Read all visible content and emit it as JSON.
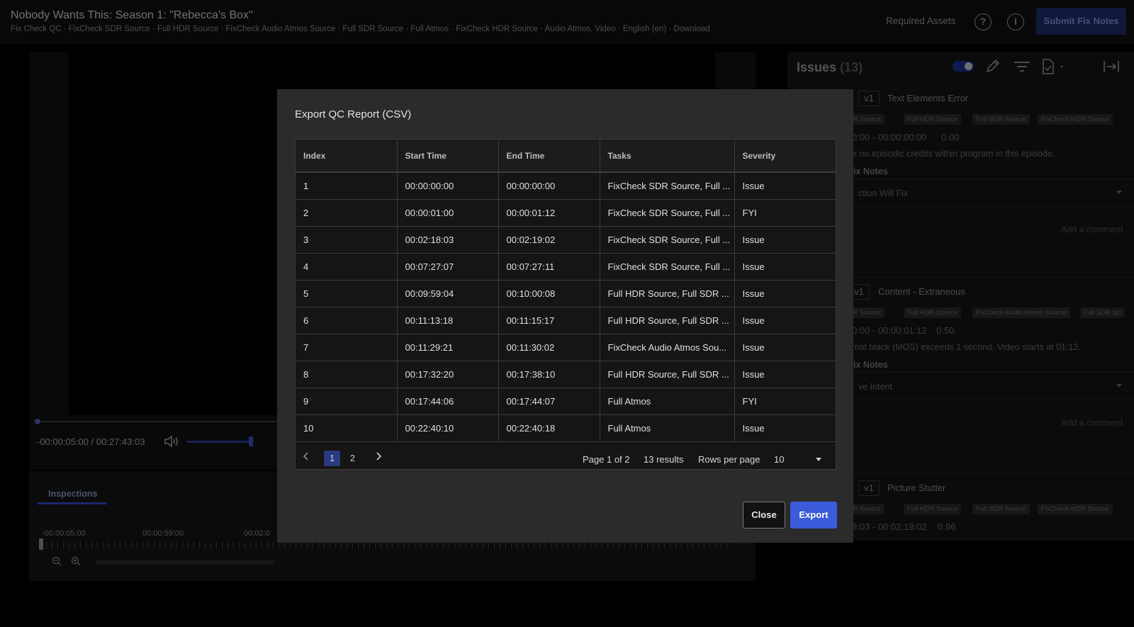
{
  "header": {
    "title": "Nobody Wants This: Season 1: \"Rebecca's Box\"",
    "subtitle": "Fix Check QC · FixCheck SDR Source · Full HDR Source · FixCheck Audio Atmos Source · Full SDR Source · Full Atmos · FixCheck HDR Source · Audio Atmos, Video · English (en) · Download",
    "required_assets": "Required Assets",
    "help_icon": "?",
    "info_icon": "i",
    "submit_label": "Submit Fix Notes"
  },
  "player": {
    "timecode": "-00:00:05:00 / 00:27:43:03",
    "volume": 0.9
  },
  "inspections": {
    "tab_label": "Inspections",
    "timeline_labels": [
      "-00:00:05:00",
      "00:00:59:00",
      "00:02:0"
    ]
  },
  "issues_panel": {
    "title": "Issues",
    "count": "(13)",
    "issues": [
      {
        "version": "v1",
        "type": "Text Elements Error",
        "chips": [
          "SDR Source",
          "Full HDR Source",
          "Full SDR Source",
          "FixCheck HDR Source"
        ],
        "time": "0:00 - 00:00:00:00",
        "score": "0.00",
        "description": "e no episodic credits within program in this episode.",
        "fix_label": "ix Notes",
        "select_value": "ction Will Fix",
        "comment_placeholder": "Add a comment"
      },
      {
        "version": "v1",
        "type": "Content - Extraneous",
        "chips": [
          "SDR Source",
          "Full HDR Source",
          "FixCheck Audio Atmos Source",
          "Full SDR So"
        ],
        "time": "0:00 - 00:00:01:12",
        "score": "0.50",
        "description": "mat black (MOS) exceeds 1 second. Video starts at 01:12.",
        "fix_label": "ix Notes",
        "select_value": "ve Intent",
        "comment_placeholder": "Add a comment"
      },
      {
        "version": "v1",
        "type": "Picture Stutter",
        "chips": [
          "SDR Source",
          "Full HDR Source",
          "Full SDR Source",
          "FixCheck HDR Source"
        ],
        "time": "8:03 - 00:02:19:02",
        "score": "0.96"
      }
    ]
  },
  "modal": {
    "title": "Export QC Report (CSV)",
    "columns": [
      "Index",
      "Start Time",
      "End Time",
      "Tasks",
      "Severity"
    ],
    "rows": [
      [
        "1",
        "00:00:00:00",
        "00:00:00:00",
        "FixCheck SDR Source, Full ...",
        "Issue"
      ],
      [
        "2",
        "00:00:01:00",
        "00:00:01:12",
        "FixCheck SDR Source, Full ...",
        "FYI"
      ],
      [
        "3",
        "00:02:18:03",
        "00:02:19:02",
        "FixCheck SDR Source, Full ...",
        "Issue"
      ],
      [
        "4",
        "00:07:27:07",
        "00:07:27:11",
        "FixCheck SDR Source, Full ...",
        "Issue"
      ],
      [
        "5",
        "00:09:59:04",
        "00:10:00:08",
        "Full HDR Source, Full SDR ...",
        "Issue"
      ],
      [
        "6",
        "00:11:13:18",
        "00:11:15:17",
        "Full HDR Source, Full SDR ...",
        "Issue"
      ],
      [
        "7",
        "00:11:29:21",
        "00:11:30:02",
        "FixCheck Audio Atmos Sou...",
        "Issue"
      ],
      [
        "8",
        "00:17:32:20",
        "00:17:38:10",
        "Full HDR Source, Full SDR ...",
        "Issue"
      ],
      [
        "9",
        "00:17:44:06",
        "00:17:44:07",
        "Full Atmos",
        "FYI"
      ],
      [
        "10",
        "00:22:40:10",
        "00:22:40:18",
        "Full Atmos",
        "Issue"
      ]
    ],
    "pagination": {
      "pages": [
        "1",
        "2"
      ],
      "page_info": "Page 1 of 2",
      "results": "13 results",
      "rows_per_page_label": "Rows per page",
      "rows_per_page_value": "10"
    },
    "close_label": "Close",
    "export_label": "Export"
  },
  "colors": {
    "accent": "#3b5bdb",
    "modal_bg": "#2b2b2b",
    "table_bg": "#151515"
  }
}
